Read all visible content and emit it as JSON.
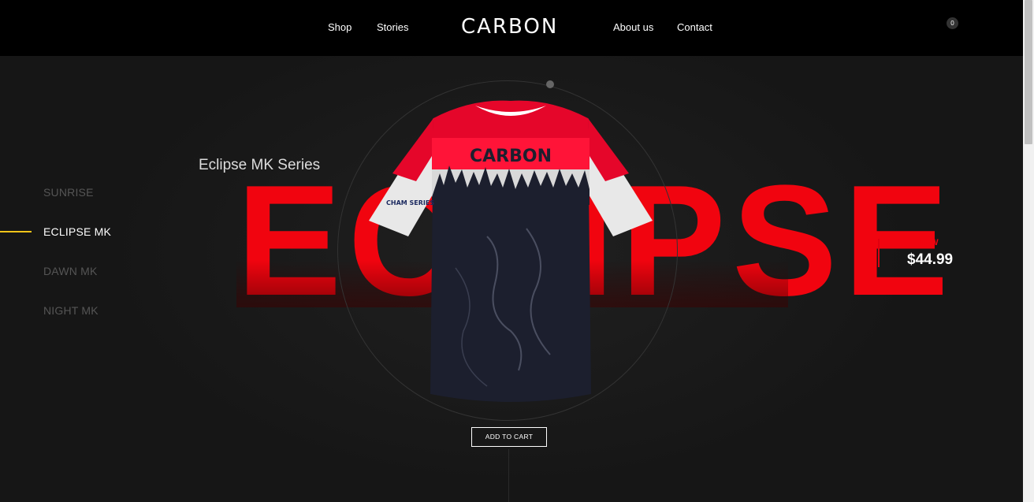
{
  "header": {
    "nav_left": [
      "Shop",
      "Stories"
    ],
    "logo": "CARBON",
    "nav_right": [
      "About us",
      "Contact"
    ],
    "cart_count": "0"
  },
  "sidebar": {
    "items": [
      {
        "label": "SUNRISE",
        "active": false
      },
      {
        "label": "ECLIPSE MK",
        "active": true
      },
      {
        "label": "DAWN MK",
        "active": false
      },
      {
        "label": "NIGHT MK",
        "active": false
      }
    ]
  },
  "hero": {
    "series_title": "Eclipse MK Series",
    "big_word": "ECLIPSE",
    "shirt_brand": "CARBON",
    "sleeve_text": "CHAM SERIES",
    "add_to_cart": "ADD TO CART"
  },
  "product": {
    "tag": "NEW",
    "price": "$44.99"
  },
  "colors": {
    "accent_red": "#f1040f",
    "active_indicator": "#f0c419",
    "background": "#161616"
  }
}
